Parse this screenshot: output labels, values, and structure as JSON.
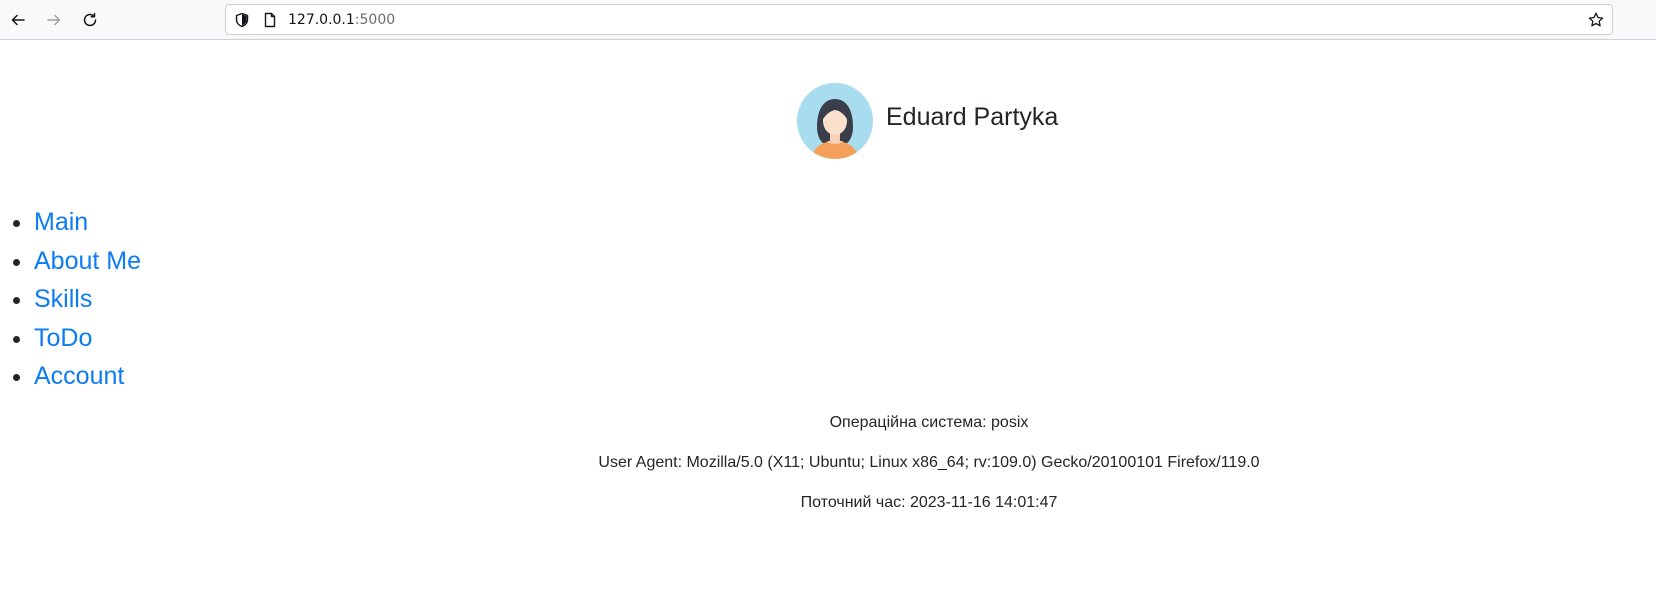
{
  "browser": {
    "url_host": "127.0.0.1",
    "url_port": ":5000",
    "icons": {
      "back": "arrow-left-icon",
      "forward": "arrow-right-icon",
      "reload": "reload-icon",
      "tracking": "shield-icon",
      "page": "page-icon",
      "bookmark": "star-icon"
    }
  },
  "profile": {
    "name": "Eduard Partyka",
    "avatar_icon": "avatar-woman-icon"
  },
  "nav": {
    "items": [
      {
        "label": "Main"
      },
      {
        "label": "About Me"
      },
      {
        "label": "Skills"
      },
      {
        "label": "ToDo"
      },
      {
        "label": "Account"
      }
    ]
  },
  "info": {
    "os": "Операційна система: posix",
    "user_agent": "User Agent: Mozilla/5.0 (X11; Ubuntu; Linux x86_64; rv:109.0) Gecko/20100101 Firefox/119.0",
    "time": "Поточний час: 2023-11-16 14:01:47"
  },
  "colors": {
    "link": "#0d7bf2",
    "text": "#212529",
    "avatar_bg": "#a8dcef"
  }
}
